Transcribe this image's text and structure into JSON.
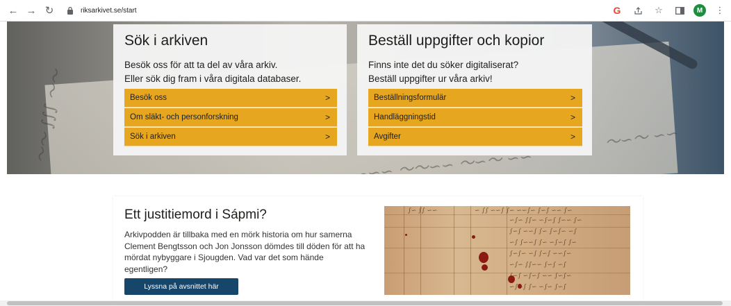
{
  "browser": {
    "url": "riksarkivet.se/start",
    "profile_initial": "M"
  },
  "hero": {
    "left_card": {
      "title": "Sök i arkiven",
      "text_line1": "Besök oss för att ta del av våra arkiv.",
      "text_line2": "Eller sök dig fram i våra digitala databaser.",
      "links": [
        "Besök oss",
        "Om släkt- och personforskning",
        "Sök i arkiven"
      ]
    },
    "right_card": {
      "title": "Beställ uppgifter och kopior",
      "text_line1": "Finns inte det du söker digitaliserat?",
      "text_line2": "Beställ uppgifter ur våra arkiv!",
      "links": [
        "Beställningsformulär",
        "Handläggningstid",
        "Avgifter"
      ]
    }
  },
  "feature": {
    "title": "Ett justitiemord i Sápmi?",
    "text": "Arkivpodden är tillbaka med en mörk historia om hur samerna Clement Bengtsson och Jon Jonsson dömdes till döden för att ha mördat nybyggare i Sjougden. Vad var det som hände egentligen?",
    "button_label": "Lyssna på avsnittet här"
  },
  "colors": {
    "link_bg": "#e7a620",
    "button_bg": "#17466b",
    "card_bg": "#f4f4f4"
  }
}
